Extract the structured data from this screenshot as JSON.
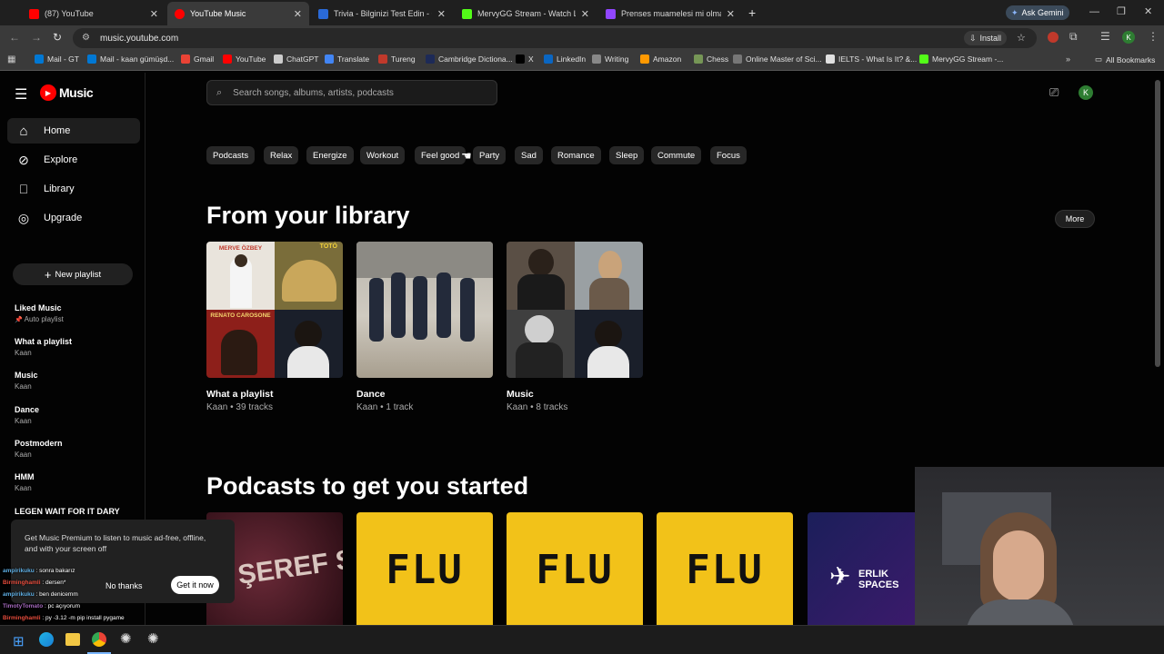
{
  "browser": {
    "tabs": [
      {
        "label": "(87) YouTube",
        "color": "#ff0000"
      },
      {
        "label": "YouTube Music",
        "color": "#ff0000"
      },
      {
        "label": "Trivia - Bilginizi Test Edin - Quiz",
        "color": "#2a6ad8"
      },
      {
        "label": "MervyGG Stream - Watch Live",
        "color": "#53fc18"
      },
      {
        "label": "Prenses muamelesi mi olmasi g",
        "color": "#9146ff"
      }
    ],
    "new_tab": "+",
    "ask_gemini": "Ask Gemini",
    "url": "music.youtube.com",
    "install_label": "Install",
    "bookmarks": [
      {
        "label": "Mail - GT",
        "color": "#0078d4"
      },
      {
        "label": "Mail - kaan gümüşd...",
        "color": "#0078d4"
      },
      {
        "label": "Gmail",
        "color": "#ea4335"
      },
      {
        "label": "YouTube",
        "color": "#ff0000"
      },
      {
        "label": "ChatGPT",
        "color": "#cccccc"
      },
      {
        "label": "Translate",
        "color": "#4285f4"
      },
      {
        "label": "Tureng",
        "color": "#c0392b"
      },
      {
        "label": "Cambridge Dictiona...",
        "color": "#1d2a57"
      },
      {
        "label": "X",
        "color": "#000000"
      },
      {
        "label": "LinkedIn",
        "color": "#0a66c2"
      },
      {
        "label": "Writing",
        "color": "#888888"
      },
      {
        "label": "Amazon",
        "color": "#ff9900"
      },
      {
        "label": "Chess",
        "color": "#769656"
      },
      {
        "label": "Online Master of Sci...",
        "color": "#777777"
      },
      {
        "label": "IELTS - What Is It? &...",
        "color": "#e0e0e0"
      },
      {
        "label": "MervyGG Stream -...",
        "color": "#53fc18"
      }
    ],
    "all_bookmarks": "All Bookmarks"
  },
  "app": {
    "logo": "Music",
    "search_placeholder": "Search songs, albums, artists, podcasts",
    "avatar_letter": "K",
    "nav": [
      {
        "label": "Home"
      },
      {
        "label": "Explore"
      },
      {
        "label": "Library"
      },
      {
        "label": "Upgrade"
      }
    ],
    "new_playlist": "New playlist",
    "playlists": [
      {
        "title": "Liked Music",
        "subtitle": "Auto playlist"
      },
      {
        "title": "What a playlist",
        "subtitle": "Kaan"
      },
      {
        "title": "Music",
        "subtitle": "Kaan"
      },
      {
        "title": "Dance",
        "subtitle": "Kaan"
      },
      {
        "title": "Postmodern",
        "subtitle": "Kaan"
      },
      {
        "title": "HMM",
        "subtitle": "Kaan"
      },
      {
        "title": "LEGEN WAIT FOR IT DARY",
        "subtitle": ""
      }
    ],
    "chips": [
      "Podcasts",
      "Relax",
      "Energize",
      "Workout",
      "Feel good",
      "Party",
      "Sad",
      "Romance",
      "Sleep",
      "Commute",
      "Focus"
    ],
    "library_title": "From your library",
    "more_label": "More",
    "library_cards": [
      {
        "title": "What a playlist",
        "subtitle": "Kaan • 39 tracks"
      },
      {
        "title": "Dance",
        "subtitle": "Kaan • 1 track"
      },
      {
        "title": "Music",
        "subtitle": "Kaan • 8 tracks"
      }
    ],
    "thumb_texts": {
      "merve": "MERVE ÖZBEY",
      "toto": "TOTÒ",
      "renato": "RENATO CAROSONE"
    },
    "podcasts_title": "Podcasts to get you started",
    "podcast_cards": [
      {
        "text": "ŞEREF SAAT"
      },
      {
        "text": "FLU"
      },
      {
        "text": "FLU"
      },
      {
        "text": "FLU"
      },
      {
        "text": "ERLIK SPACES"
      }
    ],
    "premium_popup": {
      "text": "Get Music Premium to listen to music ad-free, offline, and with your screen off",
      "no_thanks": "No thanks",
      "get_it": "Get it now"
    }
  },
  "chat_overlay": [
    {
      "user": "ampirikuku",
      "msg": "sonra bakarız",
      "color": "#5dade2"
    },
    {
      "user": "Birminghamli",
      "msg": "dersen*",
      "color": "#e74c3c"
    },
    {
      "user": "ampirikuku",
      "msg": "ben denicemm",
      "color": "#5dade2"
    },
    {
      "user": "TimotyTomato",
      "msg": "pc açıyorum",
      "color": "#a569bd"
    },
    {
      "user": "Birminghamli",
      "msg": "py -3.12 -m pip install pygame",
      "color": "#e74c3c"
    }
  ]
}
